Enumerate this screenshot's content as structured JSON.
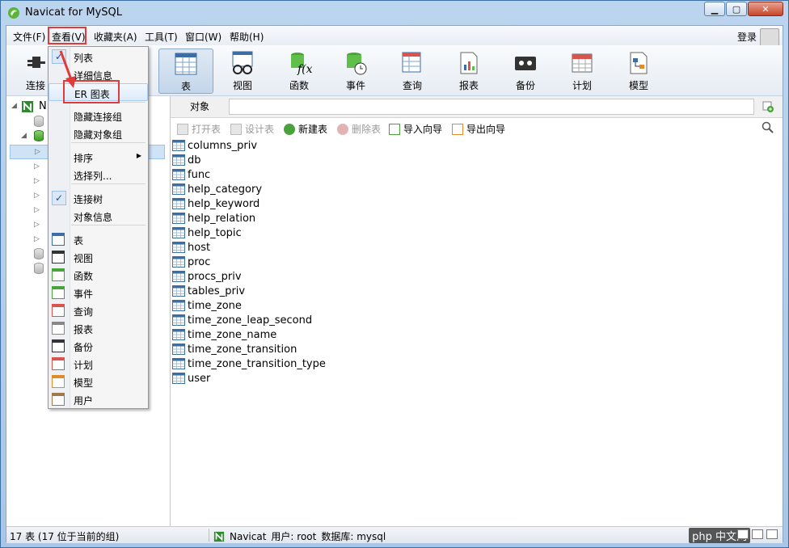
{
  "window": {
    "title": "Navicat for MySQL"
  },
  "menubar": {
    "items": [
      "文件(F)",
      "查看(V)",
      "收藏夹(A)",
      "工具(T)",
      "窗口(W)",
      "帮助(H)"
    ],
    "login": "登录"
  },
  "toolbar": {
    "items": [
      {
        "label": "连接",
        "icon": "plug-icon"
      },
      {
        "label": "表",
        "icon": "table-icon"
      },
      {
        "label": "视图",
        "icon": "view-glasses-icon"
      },
      {
        "label": "函数",
        "icon": "function-icon"
      },
      {
        "label": "事件",
        "icon": "event-clock-icon"
      },
      {
        "label": "查询",
        "icon": "query-icon"
      },
      {
        "label": "报表",
        "icon": "report-icon"
      },
      {
        "label": "备份",
        "icon": "backup-tape-icon"
      },
      {
        "label": "计划",
        "icon": "schedule-calendar-icon"
      },
      {
        "label": "模型",
        "icon": "model-icon"
      }
    ],
    "active": "表"
  },
  "tree": {
    "root_label": "N"
  },
  "object_tab": {
    "label": "对象"
  },
  "commands": [
    {
      "label": "打开表",
      "enabled": false,
      "icon": "open-table-icon"
    },
    {
      "label": "设计表",
      "enabled": false,
      "icon": "design-table-icon"
    },
    {
      "label": "新建表",
      "enabled": true,
      "icon": "new-table-icon"
    },
    {
      "label": "删除表",
      "enabled": false,
      "icon": "delete-table-icon"
    },
    {
      "label": "导入向导",
      "enabled": true,
      "icon": "import-wizard-icon"
    },
    {
      "label": "导出向导",
      "enabled": true,
      "icon": "export-wizard-icon"
    }
  ],
  "tables": [
    "columns_priv",
    "db",
    "func",
    "help_category",
    "help_keyword",
    "help_relation",
    "help_topic",
    "host",
    "proc",
    "procs_priv",
    "tables_priv",
    "time_zone",
    "time_zone_leap_second",
    "time_zone_name",
    "time_zone_transition",
    "time_zone_transition_type",
    "user"
  ],
  "dropdown": {
    "items": [
      {
        "label": "列表",
        "checked": true
      },
      {
        "label": "详细信息",
        "checked": false
      },
      {
        "label": "ER 图表",
        "checked": false
      },
      {
        "label": "隐藏连接组",
        "checked": false
      },
      {
        "label": "隐藏对象组",
        "checked": false
      },
      {
        "label": "排序",
        "submenu": true
      },
      {
        "label": "选择列...",
        "checked": false
      },
      {
        "label": "连接树",
        "checked": true
      },
      {
        "label": "对象信息",
        "checked": false
      },
      {
        "label": "表",
        "icon": "table-icon"
      },
      {
        "label": "视图",
        "icon": "view-glasses-icon"
      },
      {
        "label": "函数",
        "icon": "function-icon"
      },
      {
        "label": "事件",
        "icon": "event-clock-icon"
      },
      {
        "label": "查询",
        "icon": "query-icon"
      },
      {
        "label": "报表",
        "icon": "report-icon"
      },
      {
        "label": "备份",
        "icon": "backup-tape-icon"
      },
      {
        "label": "计划",
        "icon": "schedule-calendar-icon"
      },
      {
        "label": "模型",
        "icon": "model-icon"
      },
      {
        "label": "用户",
        "icon": "user-icon"
      }
    ]
  },
  "status": {
    "left": "17 表 (17 位于当前的组)",
    "connection": "Navicat",
    "user": "用户: root",
    "database": "数据库: mysql",
    "watermark": "php 中文网"
  },
  "colors": {
    "accent_red": "#e03a3a",
    "selection_blue": "#cfe3f7"
  }
}
